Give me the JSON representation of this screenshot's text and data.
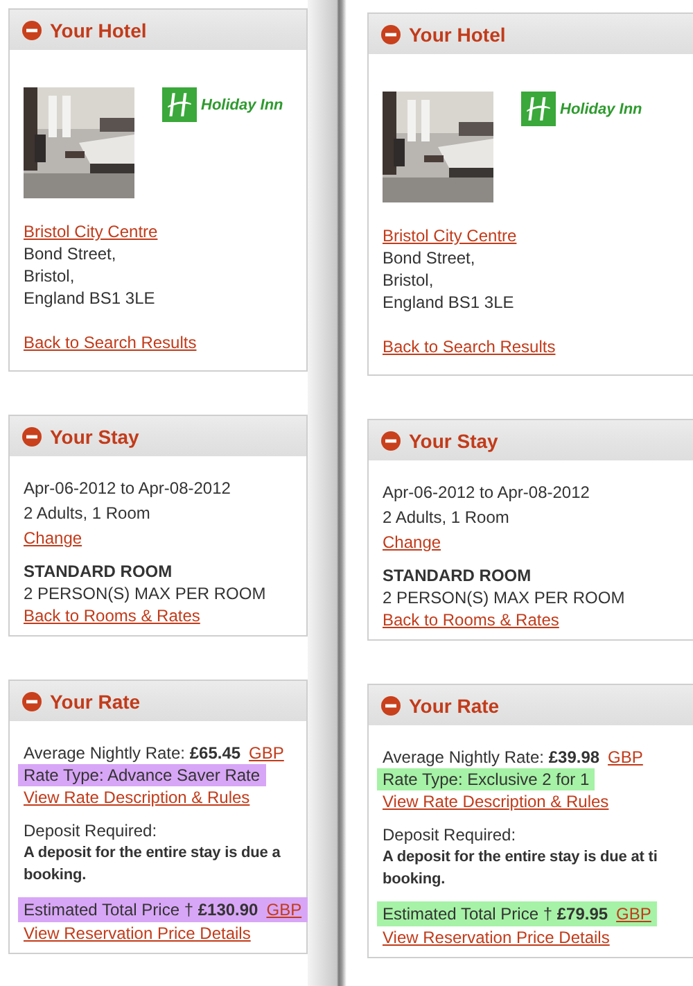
{
  "columns": [
    {
      "color": "#d8a6f6",
      "hotel": {
        "title": "Your Hotel",
        "logo_text": "Holiday Inn",
        "location_link": "Bristol City Centre",
        "address": [
          "Bond Street,",
          "Bristol,",
          "England  BS1 3LE"
        ],
        "back_link": "Back to Search Results"
      },
      "stay": {
        "title": "Your Stay",
        "dates": "Apr-06-2012 to  Apr-08-2012",
        "guests": "2 Adults, 1 Room",
        "change_link": "Change",
        "room_type": "STANDARD ROOM",
        "occupancy": "2 PERSON(S) MAX PER ROOM",
        "back_link": "Back to Rooms & Rates"
      },
      "rate": {
        "title": "Your Rate",
        "nightly": "Average Nightly Rate:  **£65.45**",
        "nightly_currency": "GBP",
        "rate_type": "Rate Type: Advance Saver Rate",
        "rate_link": "View Rate Description & Rules",
        "deposit_label": "Deposit Required:",
        "deposit_lines": [
          "A deposit for the entire stay is due a",
          "booking."
        ],
        "total": "Estimated Total Price † **£130.90**",
        "total_currency": "GBP",
        "details_link": "View Reservation Price Details"
      }
    },
    {
      "color": "#a6f2a6",
      "hotel": {
        "title": "Your Hotel",
        "logo_text": "Holiday Inn",
        "location_link": "Bristol City Centre",
        "address": [
          "Bond Street,",
          "Bristol,",
          "England  BS1 3LE"
        ],
        "back_link": "Back to Search Results"
      },
      "stay": {
        "title": "Your Stay",
        "dates": "Apr-06-2012 to  Apr-08-2012",
        "guests": "2 Adults, 1 Room",
        "change_link": "Change",
        "room_type": "STANDARD ROOM",
        "occupancy": "2 PERSON(S) MAX PER ROOM",
        "back_link": "Back to Rooms & Rates"
      },
      "rate": {
        "title": "Your Rate",
        "nightly": "Average Nightly Rate:  **£39.98**",
        "nightly_currency": "GBP",
        "rate_type": "Rate Type: Exclusive 2 for 1",
        "rate_link": "View Rate Description & Rules",
        "deposit_label": "Deposit Required:",
        "deposit_lines": [
          "A deposit for the entire stay is due at ti",
          "booking."
        ],
        "total": "Estimated Total Price † **£79.95**",
        "total_currency": "GBP",
        "details_link": "View Reservation Price Details"
      }
    }
  ]
}
